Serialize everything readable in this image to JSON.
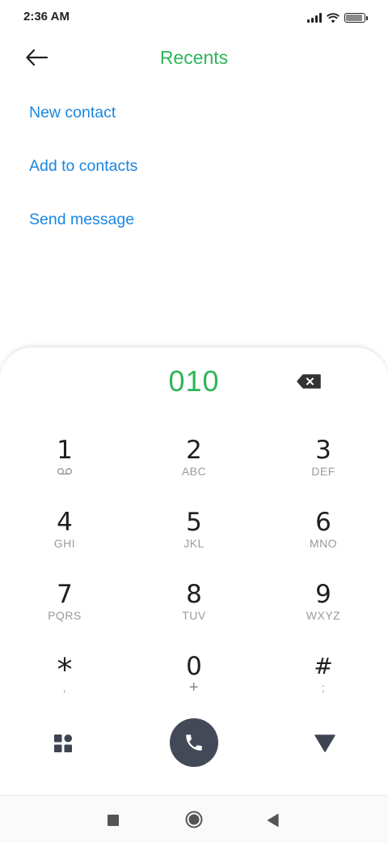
{
  "status_bar": {
    "time": "2:36 AM",
    "battery_level": 0.9
  },
  "header": {
    "title": "Recents",
    "back_icon": "back-arrow-icon"
  },
  "actions": {
    "new_contact": "New contact",
    "add_to_contacts": "Add to contacts",
    "send_message": "Send message"
  },
  "dialpad": {
    "number": "010",
    "keys": [
      {
        "digit": "1",
        "letters": ""
      },
      {
        "digit": "2",
        "letters": "ABC"
      },
      {
        "digit": "3",
        "letters": "DEF"
      },
      {
        "digit": "4",
        "letters": "GHI"
      },
      {
        "digit": "5",
        "letters": "JKL"
      },
      {
        "digit": "6",
        "letters": "MNO"
      },
      {
        "digit": "7",
        "letters": "PQRS"
      },
      {
        "digit": "8",
        "letters": "TUV"
      },
      {
        "digit": "9",
        "letters": "WXYZ"
      },
      {
        "digit": "*",
        "letters": ","
      },
      {
        "digit": "0",
        "letters": "+"
      },
      {
        "digit": "#",
        "letters": ";"
      }
    ],
    "icons": [
      "voicemail-icon",
      "backspace-icon",
      "dialpad-menu-icon",
      "phone-icon",
      "collapse-triangle-icon"
    ]
  },
  "colors": {
    "accent_green": "#2fb55a",
    "link_blue": "#1a86e0",
    "call_button": "#444958"
  }
}
